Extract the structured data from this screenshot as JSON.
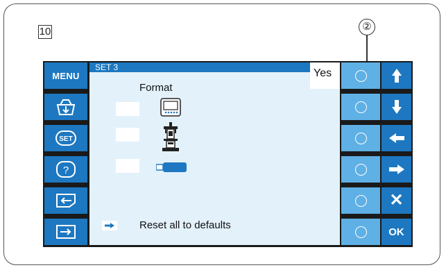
{
  "step_number": "10",
  "callout_number": "②",
  "screen": {
    "title": "SET 3",
    "yes_label": "Yes",
    "format_label": "Format",
    "reset_label": "Reset all to defaults"
  },
  "left_buttons": {
    "menu_label": "MENU",
    "set_label": "SET",
    "help_label": "?"
  },
  "nav_buttons": {
    "ok_label": "OK",
    "x_label": "✕"
  },
  "icons": [
    "save-icon",
    "set-icon",
    "help-icon",
    "page-back-icon",
    "page-forward-icon",
    "monitor-icon",
    "machine-icon",
    "usb-icon",
    "arrow-up-icon",
    "arrow-down-icon",
    "arrow-left-icon",
    "arrow-right-icon",
    "cancel-icon"
  ],
  "colors": {
    "accent": "#1d78c1",
    "light_button": "#5fb0e5",
    "panel": "#e3f1fb"
  }
}
